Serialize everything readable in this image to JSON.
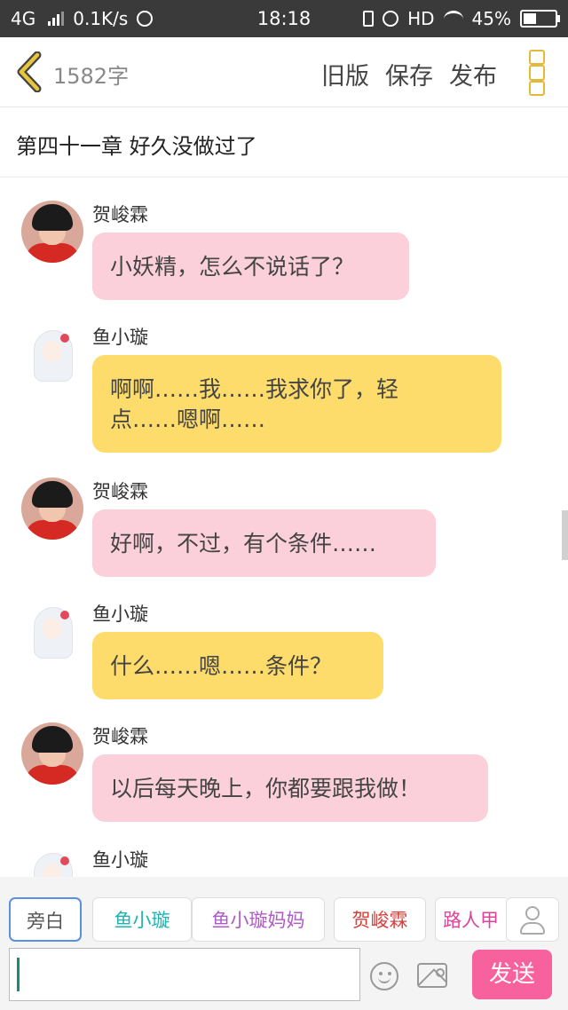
{
  "status_bar": {
    "network": "4G",
    "speed": "0.1K/s",
    "time": "18:18",
    "hd": "HD",
    "battery": "45%",
    "battery_level": 0.45
  },
  "header": {
    "word_count": "1582字",
    "old_version": "旧版",
    "save": "保存",
    "publish": "发布",
    "accent": "#e3b93a"
  },
  "chapter": {
    "title": "第四十一章 好久没做过了"
  },
  "messages": [
    {
      "name": "贺峻霖",
      "text": "小妖精，怎么不说话了？",
      "bubble_color": "#fbd0da"
    },
    {
      "name": "鱼小璇",
      "text": "啊啊……我……我求你了，轻\n点……嗯啊……",
      "bubble_color": "#fddc6c"
    },
    {
      "name": "贺峻霖",
      "text": "好啊，不过，有个条件……",
      "bubble_color": "#fbd0da"
    },
    {
      "name": "鱼小璇",
      "text": "什么……嗯……条件？",
      "bubble_color": "#fddc6c"
    },
    {
      "name": "贺峻霖",
      "text": "以后每天晚上，你都要跟我做！",
      "bubble_color": "#fbd0da"
    },
    {
      "name": "鱼小璇",
      "text": "",
      "bubble_color": "#fddc6c"
    }
  ],
  "roles": [
    {
      "label": "旁白",
      "color": "#555555",
      "selected": true
    },
    {
      "label": "鱼小璇",
      "color": "#1db3b0",
      "selected": false
    },
    {
      "label": "鱼小璇妈妈",
      "color": "#b05ac8",
      "selected": false
    },
    {
      "label": "贺峻霖",
      "color": "#d6403c",
      "selected": false
    },
    {
      "label": "路人甲",
      "color": "#e0439a",
      "selected": false
    }
  ],
  "composer": {
    "input_value": "",
    "send": "发送",
    "send_color": "#f7619d"
  }
}
